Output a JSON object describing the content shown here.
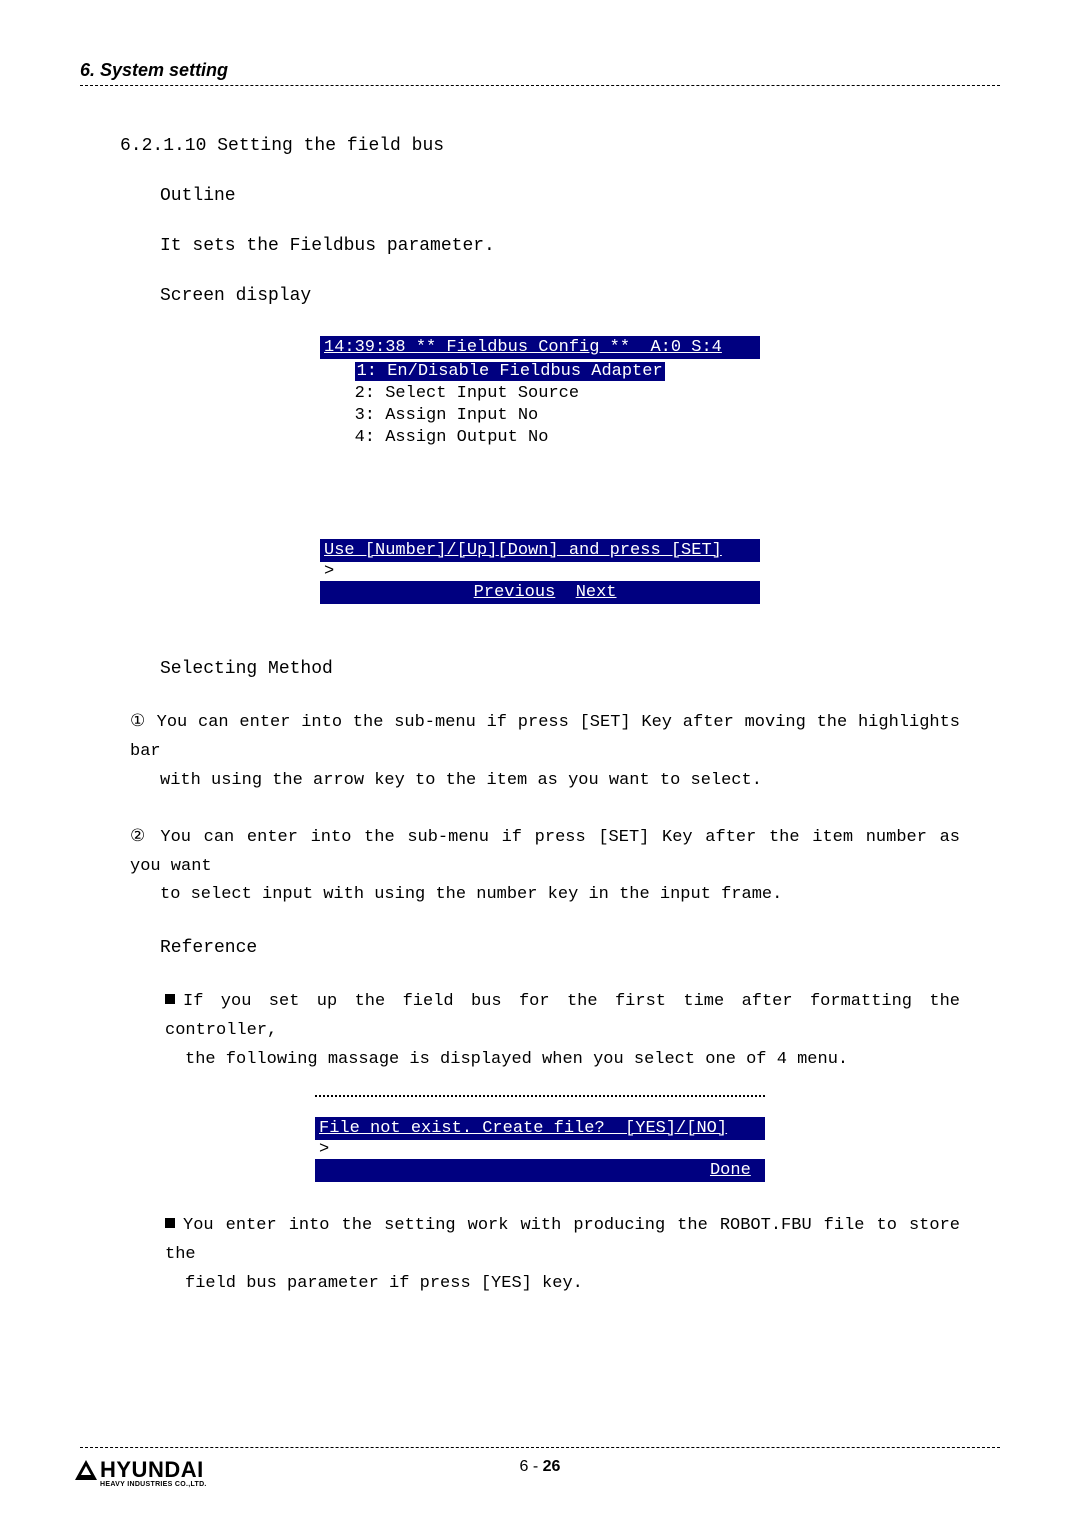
{
  "header": "6. System setting",
  "section": {
    "number": "6.2.1.10 Setting the field bus",
    "outline_label": "Outline",
    "outline_text": "It sets the Fieldbus parameter.",
    "screen_label": "Screen display"
  },
  "screen1": {
    "title": "14:39:38 ** Fieldbus Config **  A:0 S:4",
    "menu": [
      "1: En/Disable Fieldbus Adapter",
      "2: Select Input Source",
      "3: Assign Input No",
      "4: Assign Output No"
    ],
    "hint": "Use [Number]/[Up][Down] and press [SET]",
    "prompt": ">",
    "prev": "Previous",
    "next": "Next"
  },
  "selecting_label": "Selecting Method",
  "step1_a": "① You can enter into the sub-menu if press [SET] Key after moving the highlights bar",
  "step1_b": "with using the arrow key to the item as you want to select.",
  "step2_a": "② You can enter into the sub-menu if press [SET] Key after the item number as you want",
  "step2_b": "to select input with using the number key in the input frame.",
  "reference_label": "Reference",
  "ref1_a": "If you set up the field bus for the first time after formatting the controller,",
  "ref1_b": "the following massage is displayed when you select one of 4 menu.",
  "dialog": {
    "title": "File not exist. Create file?  [YES]/[NO]",
    "prompt": ">",
    "done": "Done"
  },
  "ref2_a": "You enter into the setting work with producing the ROBOT.FBU file to store the",
  "ref2_b": "field bus parameter if press [YES] key.",
  "footer": {
    "page_prefix": "6 - ",
    "page_num": "26",
    "brand": "HYUNDAI",
    "brand_sub": "HEAVY INDUSTRIES CO.,LTD."
  }
}
